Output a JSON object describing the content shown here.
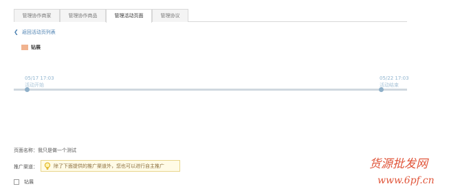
{
  "tabs": [
    {
      "label": "管理协作商家"
    },
    {
      "label": "管理协作商品"
    },
    {
      "label": "管理活动页面"
    },
    {
      "label": "管理协议"
    }
  ],
  "active_tab": 2,
  "back_link": {
    "label": "返回活动页列表"
  },
  "legend": {
    "label": "钻展",
    "color": "#f1b38f"
  },
  "timeline": {
    "start_date": "05/17 17:03",
    "start_label": "活动开始",
    "end_date": "05/22 17:03",
    "end_label": "活动结束"
  },
  "page_name": {
    "label": "页面名称：",
    "value": "我只是做一个测试"
  },
  "channel": {
    "label": "推广渠道：",
    "notice": "除了下面提供的推广渠道外，您也可以进行自主推广",
    "icon": "lightbulb-icon"
  },
  "channel_option": {
    "label": "钻展",
    "checked": false
  },
  "watermark": {
    "line1": "货源批发网",
    "line2": "www.6pf.cn"
  },
  "colors": {
    "accent": "#4a7fb0",
    "timeline": "#8fb0c9",
    "notice_border": "#e8d58a",
    "watermark": "#e0553a"
  }
}
